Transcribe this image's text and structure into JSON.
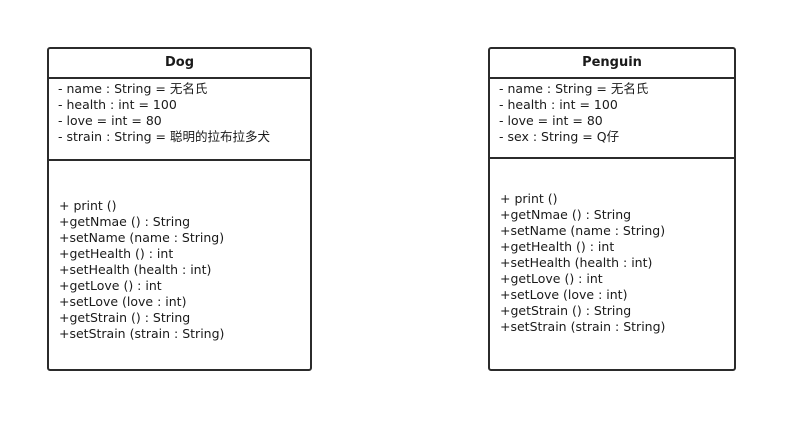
{
  "classes": [
    {
      "name": "Dog",
      "attributes": [
        "- name : String = 无名氏",
        "- health : int = 100",
        "- love = int = 80",
        "- strain : String = 聪明的拉布拉多犬"
      ],
      "methods": [
        "+ print ()",
        "+getNmae () : String",
        "+setName (name : String)",
        "+getHealth () : int",
        "+setHealth (health : int)",
        "+getLove () : int",
        "+setLove (love : int)",
        "+getStrain () : String",
        "+setStrain (strain : String)"
      ]
    },
    {
      "name": "Penguin",
      "attributes": [
        "- name : String = 无名氏",
        "- health : int = 100",
        "- love = int = 80",
        "- sex : String = Q仔"
      ],
      "methods": [
        "+ print ()",
        "+getNmae () : String",
        "+setName (name : String)",
        "+getHealth () : int",
        "+setHealth (health : int)",
        "+getLove () : int",
        "+setLove (love : int)",
        "+getStrain () : String",
        "+setStrain (strain : String)"
      ]
    }
  ]
}
